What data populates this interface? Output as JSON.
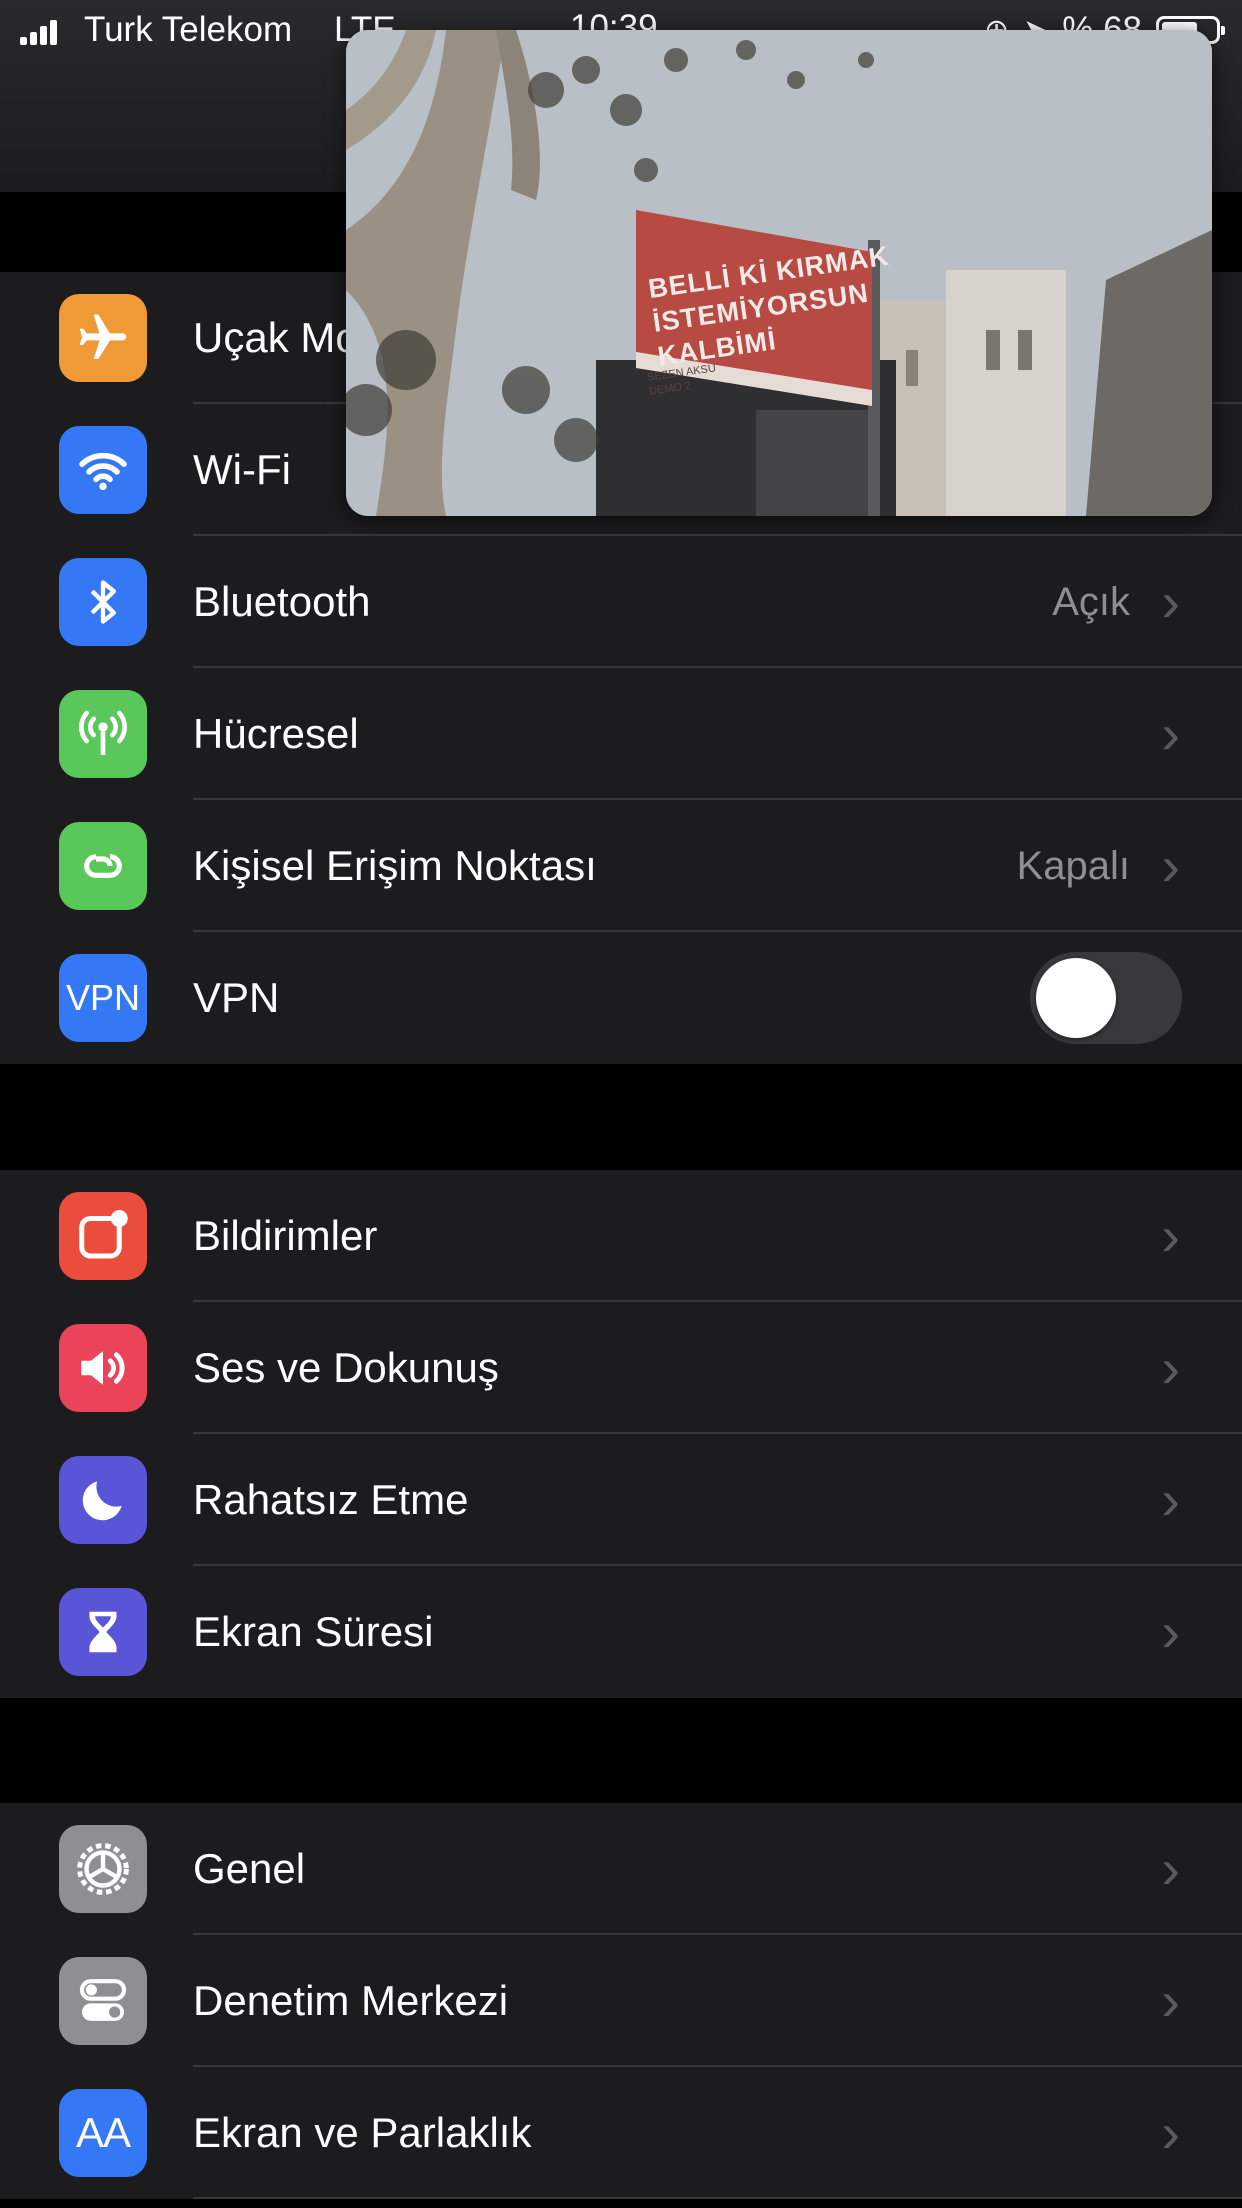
{
  "status": {
    "carrier": "Turk Telekom",
    "network": "LTE",
    "time": "10:39",
    "battery_text": "% 68",
    "battery_level": 0.68
  },
  "video": {
    "sign_line1": "BELLİ Kİ KIRMAK",
    "sign_line2": "İSTEMİYORSUN",
    "sign_line3": "KALBİMİ",
    "sign_sub1": "SEZEN AKSU",
    "sign_sub2": "DEMO 2"
  },
  "groups": [
    {
      "rows": [
        {
          "label": "Uçak Modu",
          "icon": "airplane-icon",
          "color": "#f09a37"
        },
        {
          "label": "Wi-Fi",
          "icon": "wifi-icon",
          "color": "#3478f6"
        },
        {
          "label": "Bluetooth",
          "value": "Açık",
          "icon": "bluetooth-icon",
          "color": "#3478f6"
        },
        {
          "label": "Hücresel",
          "icon": "antenna-icon",
          "color": "#5ac75a"
        },
        {
          "label": "Kişisel Erişim Noktası",
          "value": "Kapalı",
          "icon": "hotspot-icon",
          "color": "#5ac75a"
        },
        {
          "label": "VPN",
          "icon_text": "VPN",
          "icon": "vpn-icon",
          "color": "#3478f6",
          "toggle": false
        }
      ]
    },
    {
      "rows": [
        {
          "label": "Bildirimler",
          "icon": "notifications-icon",
          "color": "#eb4d3d"
        },
        {
          "label": "Ses ve Dokunuş",
          "icon": "speaker-icon",
          "color": "#eb445a"
        },
        {
          "label": "Rahatsız Etme",
          "icon": "moon-icon",
          "color": "#5856d6"
        },
        {
          "label": "Ekran Süresi",
          "icon": "hourglass-icon",
          "color": "#5856d6"
        }
      ]
    },
    {
      "rows": [
        {
          "label": "Genel",
          "icon": "gear-icon",
          "color": "#8e8e93"
        },
        {
          "label": "Denetim Merkezi",
          "icon": "switches-icon",
          "color": "#8e8e93"
        },
        {
          "label": "Ekran ve Parlaklık",
          "icon_text": "AA",
          "icon": "text-size-icon",
          "color": "#3478f6"
        }
      ]
    }
  ]
}
